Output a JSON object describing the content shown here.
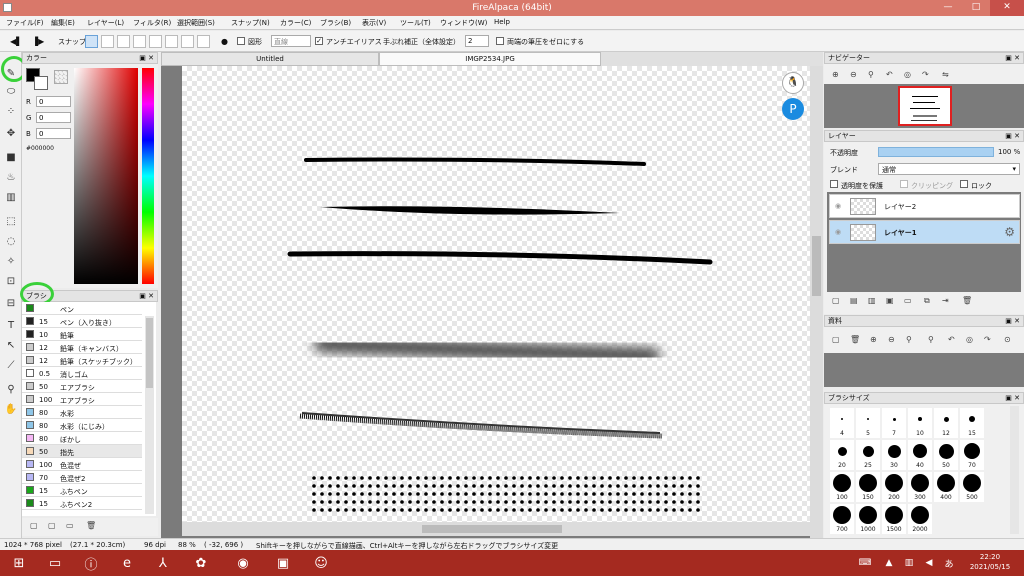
{
  "window": {
    "title": "FireAlpaca (64bit)",
    "min": "—",
    "max": "□",
    "close": "✕"
  },
  "menu": [
    "ファイル(F)",
    "編集(E)",
    "レイヤー(L)",
    "フィルタ(R)",
    "選択範囲(S)",
    "スナップ(N)",
    "カラー(C)",
    "ブラシ(B)",
    "表示(V)",
    "ツール(T)",
    "ウィンドウ(W)",
    "Help"
  ],
  "toolbar": {
    "snap": "スナップ",
    "shape": "図形",
    "shape_select": "直線",
    "antialias": "アンチエイリアス",
    "stabilizer": "手ぶれ補正（全体設定）",
    "stabilizer_value": "2",
    "zero_pressure": "両端の筆圧をゼロにする"
  },
  "color_panel": {
    "title": "カラー",
    "r_label": "R",
    "r": "0",
    "g_label": "G",
    "g": "0",
    "b_label": "B",
    "b": "0",
    "hex": "#000000"
  },
  "brush_panel": {
    "title": "ブラシ",
    "items": [
      {
        "size": "",
        "name": "ペン",
        "color": "#1a8a1a"
      },
      {
        "size": "15",
        "name": "ペン（入り抜き）",
        "color": "#222222"
      },
      {
        "size": "10",
        "name": "鉛筆",
        "color": "#222222"
      },
      {
        "size": "12",
        "name": "鉛筆（キャンバス）",
        "color": "#cccccc"
      },
      {
        "size": "12",
        "name": "鉛筆（スケッチブック）",
        "color": "#cccccc"
      },
      {
        "size": "0.5",
        "name": "消しゴム",
        "color": "#ffffff"
      },
      {
        "size": "50",
        "name": "エアブラシ",
        "color": "#cccccc"
      },
      {
        "size": "100",
        "name": "エアブラシ",
        "color": "#cccccc"
      },
      {
        "size": "80",
        "name": "水彩",
        "color": "#8fc6e8"
      },
      {
        "size": "80",
        "name": "水彩（にじみ）",
        "color": "#8fc6e8"
      },
      {
        "size": "80",
        "name": "ぼかし",
        "color": "#f5b8f5"
      },
      {
        "size": "50",
        "name": "指先",
        "color": "#f7d9b8"
      },
      {
        "size": "100",
        "name": "色混ぜ",
        "color": "#b8b8f5"
      },
      {
        "size": "70",
        "name": "色混ぜ2",
        "color": "#b8b8f5"
      },
      {
        "size": "15",
        "name": "ふちペン",
        "color": "#1aa81a"
      },
      {
        "size": "15",
        "name": "ふちペン2",
        "color": "#1a8a1a"
      }
    ]
  },
  "tabs": [
    {
      "label": "Untitled"
    },
    {
      "label": "IMGP2534.JPG"
    }
  ],
  "navigator": {
    "title": "ナビゲーター"
  },
  "layer_panel": {
    "title": "レイヤー",
    "opacity_label": "不透明度",
    "opacity_value": "100 %",
    "opacity_fraction": 1.0,
    "blend_label": "ブレンド",
    "blend_value": "通常",
    "protect_alpha": "透明度を保護",
    "clipping": "クリッピング",
    "lock": "ロック",
    "layers": [
      {
        "name": "レイヤー2"
      },
      {
        "name": "レイヤー1"
      }
    ]
  },
  "material_panel": {
    "title": "資料"
  },
  "brush_size_panel": {
    "title": "ブラシサイズ",
    "sizes": [
      "4",
      "5",
      "7",
      "10",
      "12",
      "15",
      "20",
      "25",
      "30",
      "40",
      "50",
      "70",
      "100",
      "150",
      "200",
      "300",
      "400",
      "500",
      "700",
      "1000",
      "1500",
      "2000"
    ]
  },
  "status": {
    "dims": "1024 * 768 pixel",
    "cm": "(27.1 * 20.3cm)",
    "dpi": "96 dpi",
    "zoom": "88 %",
    "coord": "( -32, 696 )",
    "hint": "Shiftキーを押しながらで直線描画、Ctrl+Altキーを押しながら左右ドラッグでブラシサイズ変更"
  },
  "taskbar": {
    "time": "22:20",
    "date": "2021/05/15"
  }
}
